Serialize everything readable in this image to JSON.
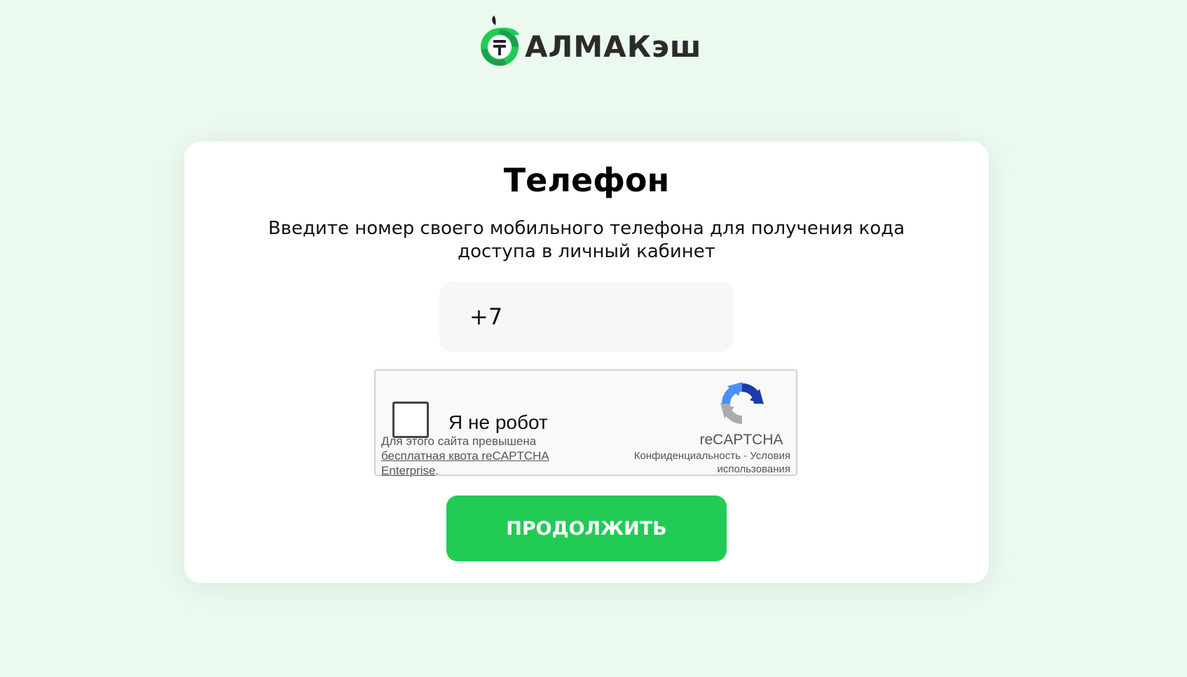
{
  "brand": {
    "name": "АЛМАКэш",
    "accent": "#22cb54",
    "dark_green": "#1e9e50",
    "icon": "tenge-apple-logo-icon"
  },
  "form": {
    "title": "Телефон",
    "subtitle": "Введите номер своего мобильного телефона для получения кода доступа в личный кабинет",
    "phone_value": "+7",
    "continue_label": "ПРОДОЛЖИТЬ"
  },
  "captcha": {
    "label": "Я не робот",
    "checked": false,
    "quota_prefix": "Для этого сайта превышена",
    "quota_link": "бесплатная квота reCAPTCHA Enterprise",
    "quota_suffix": ".",
    "brand": "reCAPTCHA",
    "privacy_label": "Конфиденциальность",
    "separator": "-",
    "terms_label": "Условия использования",
    "icon": "recaptcha-logo-icon"
  },
  "colors": {
    "background": "#ecf9ef",
    "card": "#ffffff",
    "input_background": "#f7f7f7"
  }
}
